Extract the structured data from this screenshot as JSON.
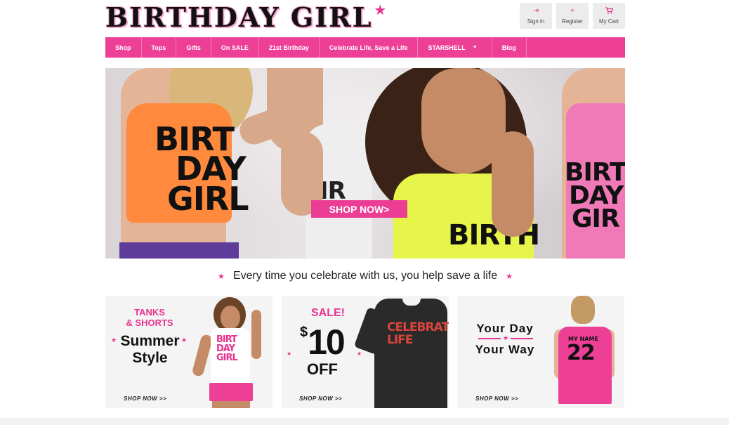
{
  "brand": {
    "logo_text": "BIRTHDAY GIRL",
    "accent": "#ee3f96"
  },
  "user_actions": [
    {
      "label": "Sign in",
      "icon": "sign-in-icon"
    },
    {
      "label": "Register",
      "icon": "plus-icon"
    },
    {
      "label": "My Cart",
      "icon": "cart-icon"
    }
  ],
  "nav": {
    "items": [
      "Shop",
      "Tops",
      "Gifts",
      "On SALE",
      "21st Birthday",
      "Celebrate Life, Save a Life",
      "STARSHELL",
      "Blog"
    ]
  },
  "hero": {
    "cta": "SHOP NOW>",
    "shirt_texts": [
      "BIRT",
      "DAY",
      "GIRL",
      "BIR",
      "BIRTH",
      "DAY",
      "GIR"
    ]
  },
  "tagline": "Every time you celebrate with us, you help save a life",
  "promos": {
    "card1": {
      "kicker_1": "TANKS",
      "kicker_2": "& SHORTS",
      "title_1": "Summer",
      "title_2": "Style",
      "shirt_1": "BIRT",
      "shirt_2": "DAY",
      "shirt_3": "GIRL",
      "shop": "SHOP NOW >>"
    },
    "card2": {
      "sale": "SALE!",
      "dollar": "$",
      "price": "10",
      "off": "OFF",
      "shirt_1": "CELEBRAT",
      "shirt_2": "LIFE",
      "shop": "SHOP NOW >>"
    },
    "card3": {
      "line_1": "Your Day",
      "line_2": "Your Way",
      "shirt_name": "MY NAME",
      "shirt_number": "22",
      "shop": "SHOP NOW >>"
    }
  }
}
